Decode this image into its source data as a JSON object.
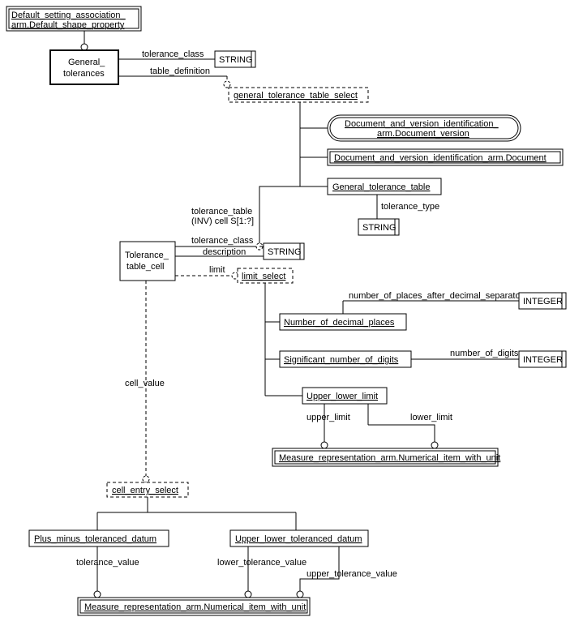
{
  "nodes": {
    "default_setting_top1": "Default_setting_association_",
    "default_setting_top2": "arm.Default_shape_property",
    "general_tolerances1": "General_",
    "general_tolerances2": "tolerances",
    "string1": "STRING",
    "string2": "STRING",
    "string3": "STRING",
    "integer1": "INTEGER",
    "integer2": "INTEGER",
    "gtt_select": "general_tolerance_table_select",
    "doc_ver1": "Document_and_version_identification_",
    "doc_ver2": "arm.Document_version",
    "doc": "Document_and_version_identification_arm.Document",
    "gtt": "General_tolerance_table",
    "ttc1": "Tolerance_",
    "ttc2": "table_cell",
    "limit_select": "limit_select",
    "nodp": "Number_of_decimal_places",
    "snod": "Significant_number_of_digits",
    "ull": "Upper_lower_limit",
    "measure1": "Measure_representation_arm.Numerical_item_with_unit",
    "measure2": "Measure_representation_arm.Numerical_item_with_unit",
    "ces": "cell_entry_select",
    "pmtd": "Plus_minus_toleranced_datum",
    "ultd": "Upper_lower_toleranced_datum"
  },
  "labels": {
    "tolerance_class1": "tolerance_class",
    "table_definition": "table_definition",
    "tolerance_type": "tolerance_type",
    "tolerance_table1": "tolerance_table",
    "tolerance_table2": "(INV) cell S[1:?]",
    "tolerance_class2": "tolerance_class",
    "description": "description",
    "limit": "limit",
    "nopads": "number_of_places_after_decimal_separator",
    "nod": "number_of_digits",
    "upper_limit": "upper_limit",
    "lower_limit": "lower_limit",
    "cell_value": "cell_value",
    "tolerance_value": "tolerance_value",
    "lower_tolerance_value": "lower_tolerance_value",
    "upper_tolerance_value": "upper_tolerance_value"
  }
}
